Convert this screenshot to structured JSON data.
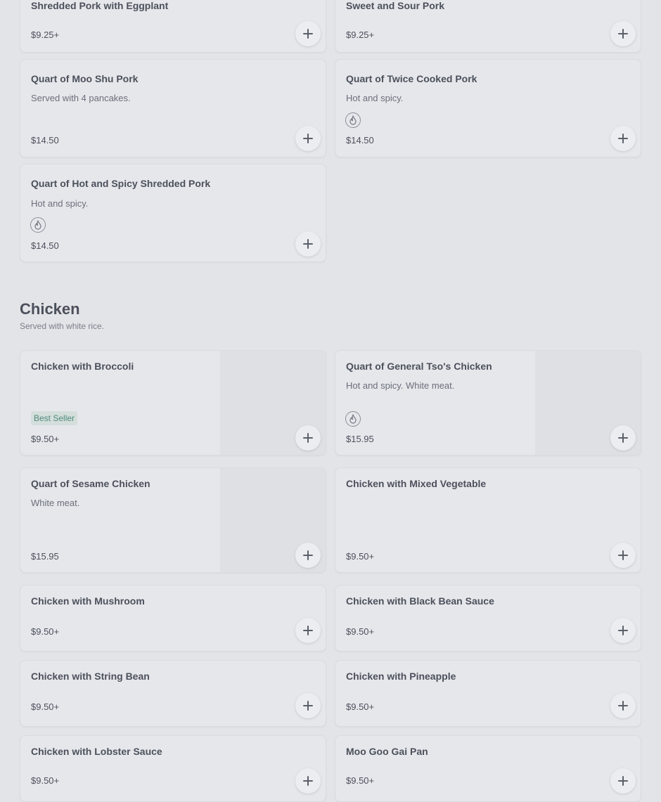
{
  "pork": {
    "items": [
      {
        "name": "Shredded Pork with Eggplant",
        "price": "$9.25+"
      },
      {
        "name": "Sweet and Sour Pork",
        "price": "$9.25+"
      },
      {
        "name": "Quart of Moo Shu Pork",
        "description": "Served with 4 pancakes.",
        "price": "$14.50"
      },
      {
        "name": "Quart of Twice Cooked Pork",
        "description": "Hot and spicy.",
        "price": "$14.50"
      },
      {
        "name": "Quart of Hot and Spicy Shredded Pork",
        "description": "Hot and spicy.",
        "price": "$14.50"
      }
    ]
  },
  "chicken": {
    "title": "Chicken",
    "subtitle": "Served with white rice.",
    "items": [
      {
        "name": "Chicken with Broccoli",
        "badge": "Best Seller",
        "price": "$9.50+"
      },
      {
        "name": "Quart of General Tso's Chicken",
        "description": "Hot and spicy. White meat.",
        "price": "$15.95"
      },
      {
        "name": "Quart of Sesame Chicken",
        "description": "White meat.",
        "price": "$15.95"
      },
      {
        "name": "Chicken with Mixed Vegetable",
        "price": "$9.50+"
      },
      {
        "name": "Chicken with Mushroom",
        "price": "$9.50+"
      },
      {
        "name": "Chicken with Black Bean Sauce",
        "price": "$9.50+"
      },
      {
        "name": "Chicken with String Bean",
        "price": "$9.50+"
      },
      {
        "name": "Chicken with Pineapple",
        "price": "$9.50+"
      },
      {
        "name": "Chicken with Lobster Sauce",
        "price": "$9.50+"
      },
      {
        "name": "Moo Goo Gai Pan",
        "price": "$9.50+"
      }
    ]
  },
  "icons": {
    "spicy": "flame-icon",
    "add": "plus-icon"
  }
}
